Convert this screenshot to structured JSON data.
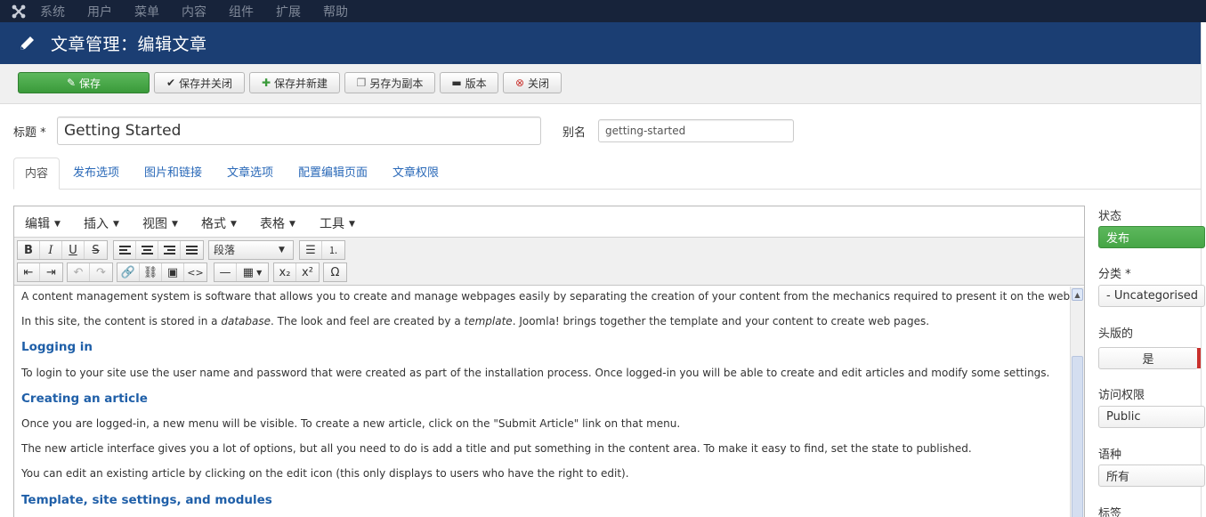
{
  "topnav": {
    "items": [
      "系统",
      "用户",
      "菜单",
      "内容",
      "组件",
      "扩展",
      "帮助"
    ]
  },
  "header": {
    "title": "文章管理：编辑文章"
  },
  "toolbar": {
    "save": "保存",
    "save_close": "保存并关闭",
    "save_new": "保存并新建",
    "save_copy": "另存为副本",
    "versions": "版本",
    "close": "关闭"
  },
  "form": {
    "title_label": "标题 *",
    "title_value": "Getting Started",
    "alias_label": "别名",
    "alias_value": "getting-started"
  },
  "tabs": [
    "内容",
    "发布选项",
    "图片和链接",
    "文章选项",
    "配置编辑页面",
    "文章权限"
  ],
  "editor": {
    "menus": [
      "编辑",
      "插入",
      "视图",
      "格式",
      "表格",
      "工具"
    ],
    "format_select": "段落",
    "content": [
      {
        "type": "p",
        "text": "A content management system is software that allows you to create and manage webpages easily by separating the creation of your content from the mechanics required to present it on the web."
      },
      {
        "type": "p_mixed",
        "parts": [
          "In this site, the content is stored in a ",
          "database",
          ". The look and feel are created by a ",
          "template",
          ". Joomla! brings together the template and your content to create web pages."
        ]
      },
      {
        "type": "h",
        "text": "Logging in"
      },
      {
        "type": "p",
        "text": "To login to your site use the user name and password that were created as part of the installation process. Once logged-in you will be able to create and edit articles and modify some settings."
      },
      {
        "type": "h",
        "text": "Creating an article"
      },
      {
        "type": "p",
        "text": "Once you are logged-in, a new menu will be visible. To create a new article, click on the \"Submit Article\" link on that menu."
      },
      {
        "type": "p",
        "text": "The new article interface gives you a lot of options, but all you need to do is add a title and put something in the content area. To make it easy to find, set the state to published."
      },
      {
        "type": "p",
        "text": "You can edit an existing article by clicking on the edit icon (this only displays to users who have the right to edit)."
      },
      {
        "type": "h",
        "text": "Template, site settings, and modules"
      }
    ]
  },
  "sidebar": {
    "status_label": "状态",
    "status_value": "发布",
    "category_label": "分类 *",
    "category_value": "- Uncategorised",
    "featured_label": "头版的",
    "featured_value": "是",
    "access_label": "访问权限",
    "access_value": "Public",
    "language_label": "语种",
    "language_value": "所有",
    "tags_label": "标签"
  },
  "colors": {
    "topnav_bg": "#17233a",
    "header_bg": "#1b3e73",
    "success": "#46a546",
    "link": "#1f5fa8"
  }
}
